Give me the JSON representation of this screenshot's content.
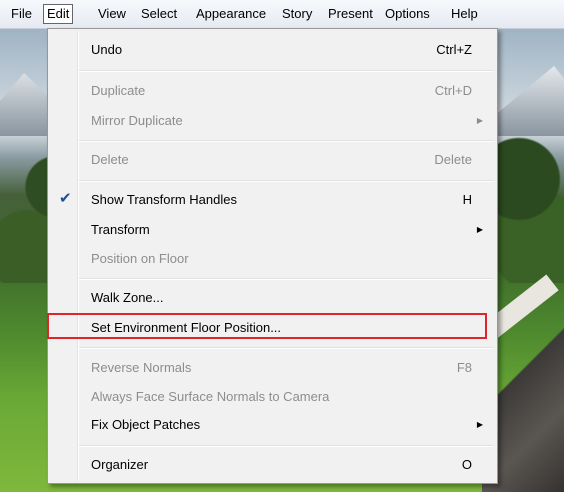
{
  "menubar": {
    "items": [
      {
        "label": "File"
      },
      {
        "label": "Edit",
        "active": true
      },
      {
        "label": "View"
      },
      {
        "label": "Select"
      },
      {
        "label": "Appearance"
      },
      {
        "label": "Story"
      },
      {
        "label": "Present"
      },
      {
        "label": "Options"
      },
      {
        "label": "Help"
      }
    ]
  },
  "edit_menu": {
    "undo": {
      "label": "Undo",
      "shortcut": "Ctrl+Z",
      "enabled": true
    },
    "duplicate": {
      "label": "Duplicate",
      "shortcut": "Ctrl+D",
      "enabled": false
    },
    "mirror_duplicate": {
      "label": "Mirror Duplicate",
      "enabled": false,
      "submenu": true
    },
    "delete": {
      "label": "Delete",
      "shortcut": "Delete",
      "enabled": false
    },
    "show_transform_handles": {
      "label": "Show Transform Handles",
      "shortcut": "H",
      "enabled": true,
      "checked": true
    },
    "transform": {
      "label": "Transform",
      "enabled": true,
      "submenu": true
    },
    "position_on_floor": {
      "label": "Position on Floor",
      "enabled": false
    },
    "walk_zone": {
      "label": "Walk Zone...",
      "enabled": true
    },
    "set_environment_floor_position": {
      "label": "Set Environment Floor Position...",
      "enabled": true,
      "highlighted": true
    },
    "reverse_normals": {
      "label": "Reverse Normals",
      "shortcut": "F8",
      "enabled": false
    },
    "always_face_surface_normals": {
      "label": "Always Face Surface Normals to Camera",
      "enabled": false
    },
    "fix_object_patches": {
      "label": "Fix Object Patches",
      "enabled": true,
      "submenu": true
    },
    "organizer": {
      "label": "Organizer",
      "shortcut": "O",
      "enabled": true
    }
  },
  "icons": {
    "check": "check-icon",
    "submenu_arrow": "triangle-right-icon"
  },
  "colors": {
    "highlight_border": "#e1242b",
    "check_mark": "#1d4f9a",
    "disabled_text": "#8d8d8d"
  }
}
